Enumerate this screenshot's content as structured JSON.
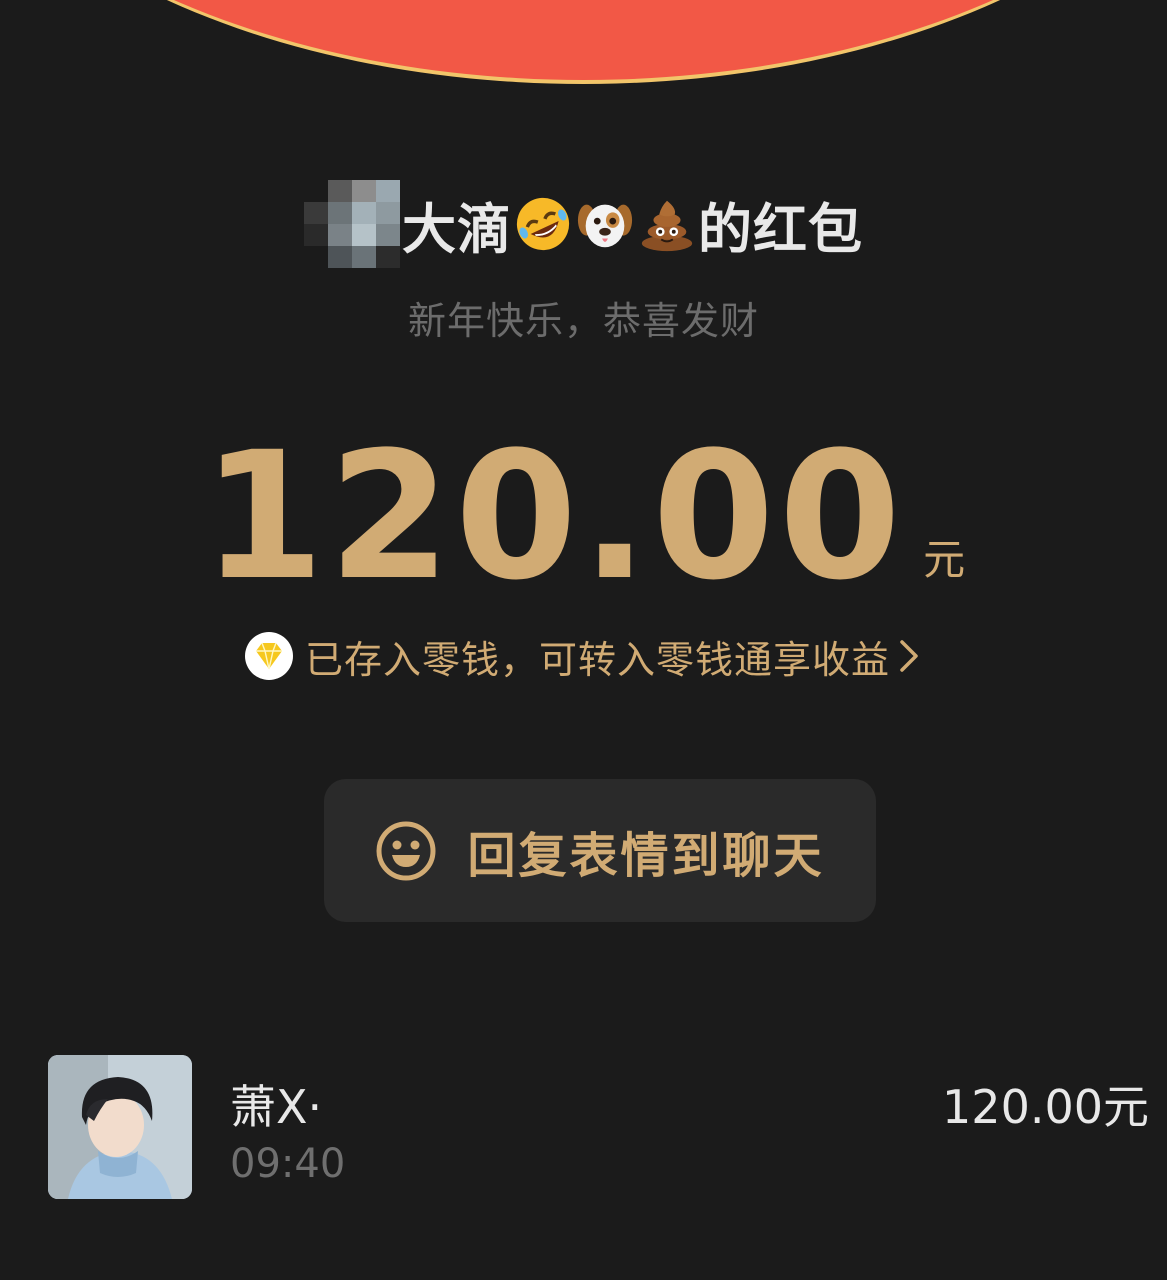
{
  "envelope": {
    "top_color": "#f25846",
    "rim_color": "#f2c56a"
  },
  "sender": {
    "name_visible": "大滴",
    "emojis": [
      "rolling-laughing-emoji",
      "dog-face-emoji",
      "poop-emoji"
    ],
    "suffix": "的红包",
    "avatar_mosaic": "pixelated-censored-avatar"
  },
  "blessing": "新年快乐，恭喜发财",
  "amount": {
    "value": "120.00",
    "unit": "元",
    "color": "#d1ab74"
  },
  "notice": {
    "icon": "diamond-icon",
    "text": "已存入零钱，可转入零钱通享收益"
  },
  "reply_button": {
    "icon": "smile-icon",
    "label": "回复表情到聊天"
  },
  "receiver": {
    "name": "萧X·",
    "time": "09:40",
    "amount": "120.00元"
  }
}
